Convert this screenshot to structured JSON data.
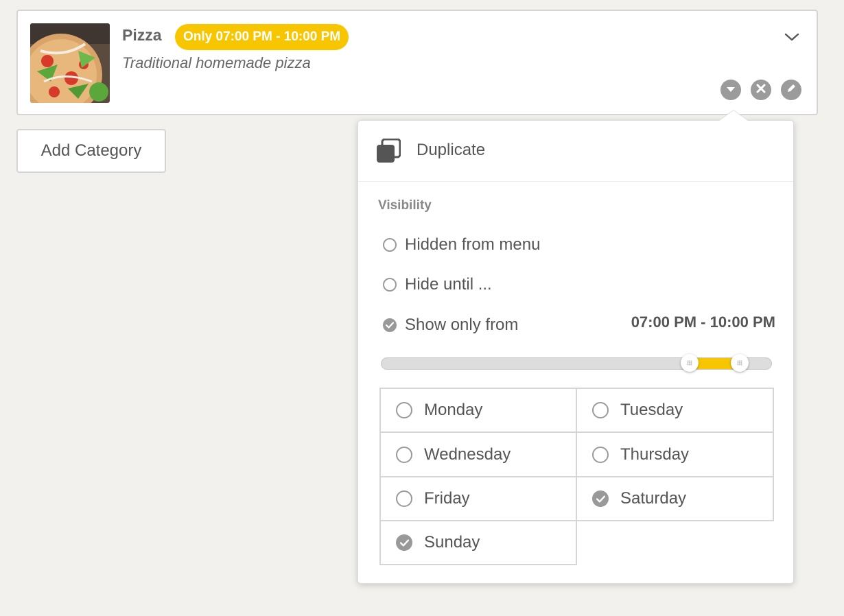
{
  "category": {
    "title": "Pizza",
    "badge": "Only 07:00 PM - 10:00 PM",
    "subtitle": "Traditional homemade pizza",
    "image_alt": "pizza photo"
  },
  "add_category_label": "Add Category",
  "popover": {
    "duplicate_label": "Duplicate",
    "visibility_title": "Visibility",
    "options": [
      {
        "label": "Hidden from menu",
        "checked": false
      },
      {
        "label": "Hide until ...",
        "checked": false
      },
      {
        "label": "Show only from",
        "checked": true
      }
    ],
    "time_range": "07:00 PM - 10:00 PM",
    "slider": {
      "start_fraction": 0.79,
      "end_fraction": 0.917
    },
    "days": [
      {
        "label": "Monday",
        "checked": false
      },
      {
        "label": "Tuesday",
        "checked": false
      },
      {
        "label": "Wednesday",
        "checked": false
      },
      {
        "label": "Thursday",
        "checked": false
      },
      {
        "label": "Friday",
        "checked": false
      },
      {
        "label": "Saturday",
        "checked": true
      },
      {
        "label": "Sunday",
        "checked": true
      }
    ]
  },
  "colors": {
    "accent": "#f7c600",
    "icon_gray": "#9b9b9b",
    "background": "#f2f1ed"
  },
  "icons": {
    "chevron": "chevron-down-icon",
    "dropdown": "caret-down-icon",
    "delete": "close-icon",
    "edit": "pencil-icon",
    "duplicate": "duplicate-icon",
    "check": "check-icon"
  }
}
